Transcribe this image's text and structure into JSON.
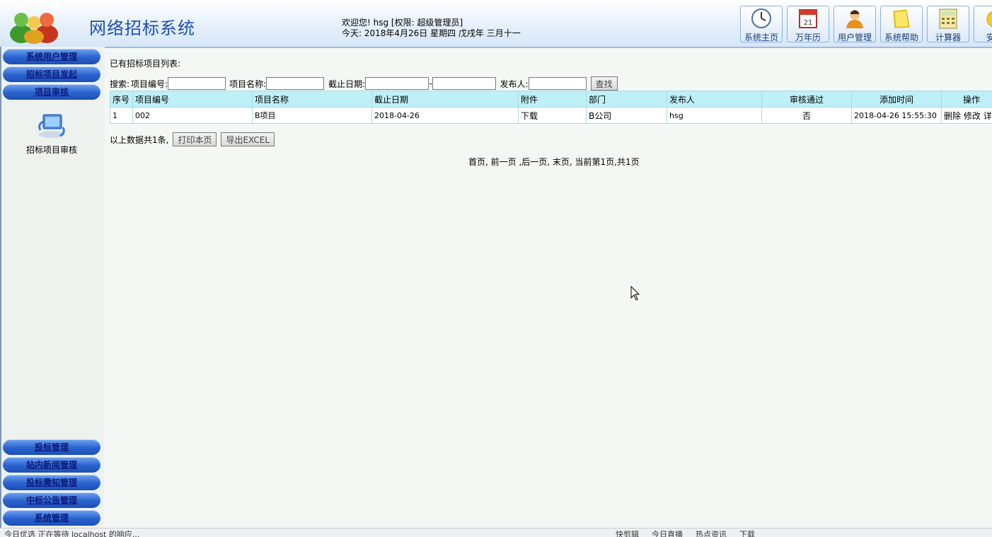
{
  "header": {
    "title": "网络招标系统",
    "welcome_line": "欢迎您! hsg [权限: 超级管理员]",
    "today_line": "今天:  2018年4月26日 星期四 戊戌年 三月十一",
    "tools": [
      {
        "label": "系统主页",
        "icon": "clock-icon"
      },
      {
        "label": "万年历",
        "icon": "calendar-icon",
        "badge": "21"
      },
      {
        "label": "用户管理",
        "icon": "user-icon"
      },
      {
        "label": "系统帮助",
        "icon": "help-folder-icon"
      },
      {
        "label": "计算器",
        "icon": "calculator-icon"
      },
      {
        "label": "安全",
        "icon": "lock-icon"
      }
    ]
  },
  "sidebar": {
    "top_menu": [
      "系统用户管理",
      "招标项目发起",
      "项目审核"
    ],
    "sub_item": "招标项目审核",
    "bottom_menu": [
      "投标管理",
      "站内新闻管理",
      "投标需知管理",
      "中标公告管理",
      "系统管理"
    ]
  },
  "main": {
    "list_title": "已有招标项目列表:",
    "search": {
      "prefix": "搜索:",
      "project_no_label": "项目编号:",
      "project_name_label": "项目名称:",
      "deadline_label": "截止日期:",
      "range_sep": "-",
      "publisher_label": "发布人:",
      "search_button": "查找"
    },
    "table": {
      "columns": [
        "序号",
        "项目编号",
        "项目名称",
        "截止日期",
        "附件",
        "部门",
        "发布人",
        "审核通过",
        "添加时间",
        "操作"
      ],
      "rows": [
        {
          "index": "1",
          "project_no": "002",
          "project_name": "B项目",
          "deadline": "2018-04-26",
          "attachment": "下载",
          "department": "B公司",
          "publisher": "hsg",
          "approved": "否",
          "added_time": "2018-04-26 15:55:30",
          "actions": [
            "删除",
            "修改",
            "详"
          ]
        }
      ]
    },
    "summary": "以上数据共1条,",
    "print_button": "打印本页",
    "export_button": "导出EXCEL",
    "pager": "首页, 前一页 ,后一页, 末页, 当前第1页,共1页"
  },
  "statusbar": {
    "left": "今日优选  正在等待 localhost 的响应...",
    "right": [
      "快剪辑",
      "今日直播",
      "热点资讯",
      "下载"
    ]
  },
  "colors": {
    "title_blue": "#1a4fb4",
    "menu_blue": "#2a62cf",
    "table_header": "#bff0f8"
  }
}
